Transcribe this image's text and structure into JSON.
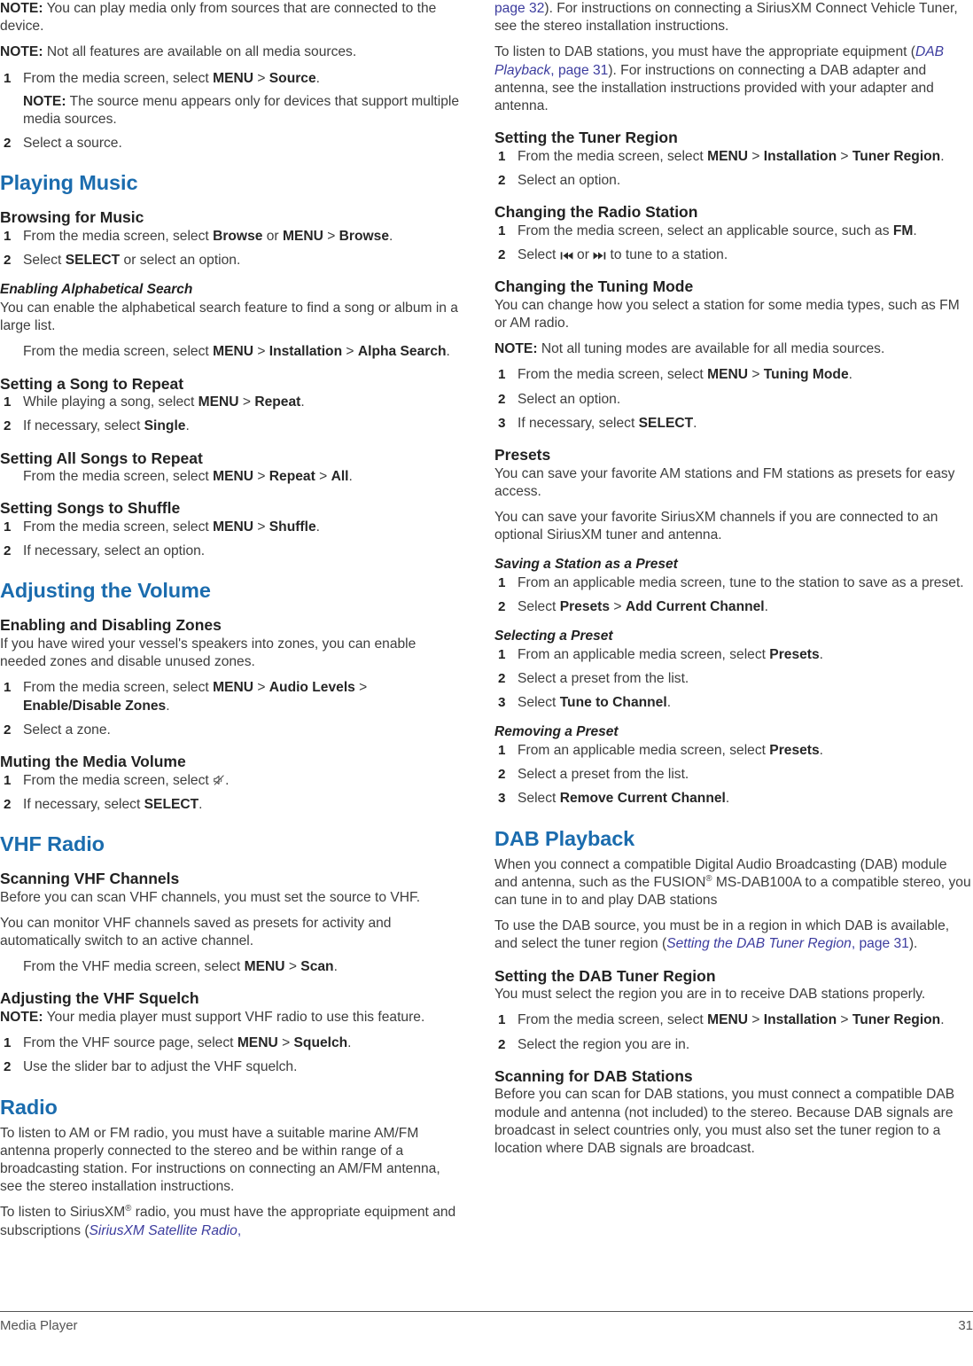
{
  "document": {
    "footer_section": "Media Player",
    "page_number": "31",
    "heading_color": "#1b6cae",
    "xref_color": "#3c3c9e",
    "body_color": "#3d3d3d"
  },
  "icons": {
    "mute": "mute-speaker-icon",
    "prev": "skip-backward-icon",
    "next": "skip-forward-icon"
  },
  "left_column": {
    "note_play_media": {
      "label": "NOTE:",
      "text": " You can play media only from sources that are connected to the device."
    },
    "note_not_all_features": {
      "label": "NOTE:",
      "text": " Not all features are available on all media sources."
    },
    "source_steps": {
      "s1_a": "From the media screen, select ",
      "s1_menu": "MENU",
      "s1_gt": " > ",
      "s1_source": "Source",
      "s1_end": ".",
      "s1_note_label": "NOTE:",
      "s1_note_text": " The source menu appears only for devices that support multiple media sources.",
      "s2": "Select a source."
    },
    "playing_music": {
      "title": "Playing Music",
      "browsing": {
        "title": "Browsing for Music",
        "s1_a": "From the media screen, select ",
        "s1_browse": "Browse",
        "s1_or": " or ",
        "s1_menu": "MENU",
        "s1_gt": " > ",
        "s1_browse2": "Browse",
        "s1_end": ".",
        "s2_a": "Select ",
        "s2_select": "SELECT",
        "s2_end": " or select an option."
      },
      "alpha_search": {
        "title": "Enabling Alphabetical Search",
        "intro": "You can enable the alphabetical search feature to find a song or album in a large list.",
        "step_a": "From the media screen, select ",
        "step_menu": "MENU",
        "step_gt1": " > ",
        "step_installation": "Installation",
        "step_gt2": " > ",
        "step_alpha": "Alpha Search",
        "step_end": "."
      },
      "song_repeat": {
        "title": "Setting a Song to Repeat",
        "s1_a": "While playing a song, select ",
        "s1_menu": "MENU",
        "s1_gt": " > ",
        "s1_repeat": "Repeat",
        "s1_end": ".",
        "s2_a": "If necessary, select ",
        "s2_single": "Single",
        "s2_end": "."
      },
      "all_repeat": {
        "title": "Setting All Songs to Repeat",
        "step_a": "From the media screen, select ",
        "step_menu": "MENU",
        "step_gt1": " > ",
        "step_repeat": "Repeat",
        "step_gt2": " > ",
        "step_all": "All",
        "step_end": "."
      },
      "shuffle": {
        "title": "Setting Songs to Shuffle",
        "s1_a": "From the media screen, select ",
        "s1_menu": "MENU",
        "s1_gt": " > ",
        "s1_shuffle": "Shuffle",
        "s1_end": ".",
        "s2": "If necessary, select an option."
      }
    },
    "adjusting_volume": {
      "title": "Adjusting the Volume",
      "zones": {
        "title": "Enabling and Disabling Zones",
        "intro": "If you have wired your vessel's speakers into zones, you can enable needed zones and disable unused zones.",
        "s1_a": "From the media screen, select ",
        "s1_menu": "MENU",
        "s1_gt1": " > ",
        "s1_audio": "Audio Levels",
        "s1_gt2": " > ",
        "s1_enable": "Enable/Disable Zones",
        "s1_end": ".",
        "s2": "Select a zone."
      },
      "muting": {
        "title": "Muting the Media Volume",
        "s1_a": "From the media screen, select ",
        "s1_end": ".",
        "s2_a": "If necessary, select ",
        "s2_select": "SELECT",
        "s2_end": "."
      }
    },
    "vhf_radio": {
      "title": "VHF Radio",
      "scanning": {
        "title": "Scanning VHF Channels",
        "p1": "Before you can scan VHF channels, you must set the source to VHF.",
        "p2": "You can monitor VHF channels saved as presets for activity and automatically switch to an active channel.",
        "step_a": "From the VHF media screen, select ",
        "step_menu": "MENU",
        "step_gt": " > ",
        "step_scan": "Scan",
        "step_end": "."
      },
      "squelch": {
        "title": "Adjusting the VHF Squelch",
        "note_label": "NOTE:",
        "note_text": " Your media player must support VHF radio to use this feature.",
        "s1_a": "From the VHF source page, select ",
        "s1_menu": "MENU",
        "s1_gt": " > ",
        "s1_squelch": "Squelch",
        "s1_end": ".",
        "s2": "Use the slider bar to adjust the VHF squelch."
      }
    },
    "radio": {
      "title": "Radio",
      "p1": "To listen to AM or FM radio, you must have a suitable marine AM/FM antenna properly connected to the stereo and be within range of a broadcasting station. For instructions on connecting an AM/FM antenna, see the stereo installation instructions.",
      "p2_a": "To listen to SiriusXM",
      "p2_reg": "®",
      "p2_b": " radio, you must have the appropriate equipment and subscriptions (",
      "p2_xref": "SiriusXM Satellite Radio",
      "p2_comma": ","
    }
  },
  "right_column": {
    "radio_cont": {
      "p1_xref": "page 32",
      "p1_b": "). For instructions on connecting a SiriusXM Connect Vehicle Tuner, see the stereo installation instructions.",
      "p2_a": "To listen to DAB stations, you must have the appropriate equipment (",
      "p2_xref_i": "DAB Playback",
      "p2_comma": ", ",
      "p2_xref_p": "page 31",
      "p2_b": "). For instructions on connecting a DAB adapter and antenna, see the installation instructions provided with your adapter and antenna."
    },
    "tuner_region": {
      "title": "Setting the Tuner Region",
      "s1_a": "From the media screen, select ",
      "s1_menu": "MENU",
      "s1_gt1": " > ",
      "s1_installation": "Installation",
      "s1_gt2": " > ",
      "s1_tuner": "Tuner Region",
      "s1_end": ".",
      "s2": "Select an option."
    },
    "changing_station": {
      "title": "Changing the Radio Station",
      "s1_a": "From the media screen, select an applicable source, such as ",
      "s1_fm": "FM",
      "s1_end": ".",
      "s2_a": "Select ",
      "s2_or": " or ",
      "s2_end": " to tune to a station."
    },
    "tuning_mode": {
      "title": "Changing the Tuning Mode",
      "intro": "You can change how you select a station for some media types, such as FM or AM radio.",
      "note_label": "NOTE:",
      "note_text": " Not all tuning modes are available for all media sources.",
      "s1_a": "From the media screen, select ",
      "s1_menu": "MENU",
      "s1_gt": " > ",
      "s1_tuning": "Tuning Mode",
      "s1_end": ".",
      "s2": "Select an option.",
      "s3_a": "If necessary, select ",
      "s3_select": "SELECT",
      "s3_end": "."
    },
    "presets": {
      "title": "Presets",
      "p1": "You can save your favorite AM stations and FM stations as presets for easy access.",
      "p2": "You can save your favorite SiriusXM channels if you are connected to an optional SiriusXM tuner and antenna.",
      "saving": {
        "title": "Saving a Station as a Preset",
        "s1": "From an applicable media screen, tune to the station to save as a preset.",
        "s2_a": "Select ",
        "s2_presets": "Presets",
        "s2_gt": " > ",
        "s2_add": "Add Current Channel",
        "s2_end": "."
      },
      "selecting": {
        "title": "Selecting a Preset",
        "s1_a": "From an applicable media screen, select ",
        "s1_presets": "Presets",
        "s1_end": ".",
        "s2": "Select a preset from the list.",
        "s3_a": "Select ",
        "s3_tune": "Tune to Channel",
        "s3_end": "."
      },
      "removing": {
        "title": "Removing a Preset",
        "s1_a": "From an applicable media screen, select ",
        "s1_presets": "Presets",
        "s1_end": ".",
        "s2": "Select a preset from the list.",
        "s3_a": "Select ",
        "s3_remove": "Remove Current Channel",
        "s3_end": "."
      }
    },
    "dab_playback": {
      "title": "DAB Playback",
      "p1_a": "When you connect a compatible Digital Audio Broadcasting (DAB) module and antenna, such as the FUSION",
      "p1_reg": "®",
      "p1_b": " MS-DAB100A to a compatible stereo, you can tune in to and play DAB stations",
      "p2_a": "To use the DAB source, you must be in a region in which DAB is available, and select the tuner region (",
      "p2_xref_i": "Setting the DAB Tuner Region",
      "p2_comma": ", ",
      "p2_xref_p": "page 31",
      "p2_end": ").",
      "dab_tuner_region": {
        "title": "Setting the DAB Tuner Region",
        "intro": "You must select the region you are in to receive DAB stations properly.",
        "s1_a": "From the media screen, select ",
        "s1_menu": "MENU",
        "s1_gt1": " > ",
        "s1_installation": "Installation",
        "s1_gt2": " > ",
        "s1_tuner": "Tuner Region",
        "s1_end": ".",
        "s2": "Select the region you are in."
      },
      "scanning": {
        "title": "Scanning for DAB Stations",
        "intro": "Before you can scan for DAB stations, you must connect a compatible DAB module and antenna (not included) to the stereo. Because DAB signals are broadcast in select countries only, you must also set the tuner region to a location where DAB signals are broadcast."
      }
    }
  }
}
